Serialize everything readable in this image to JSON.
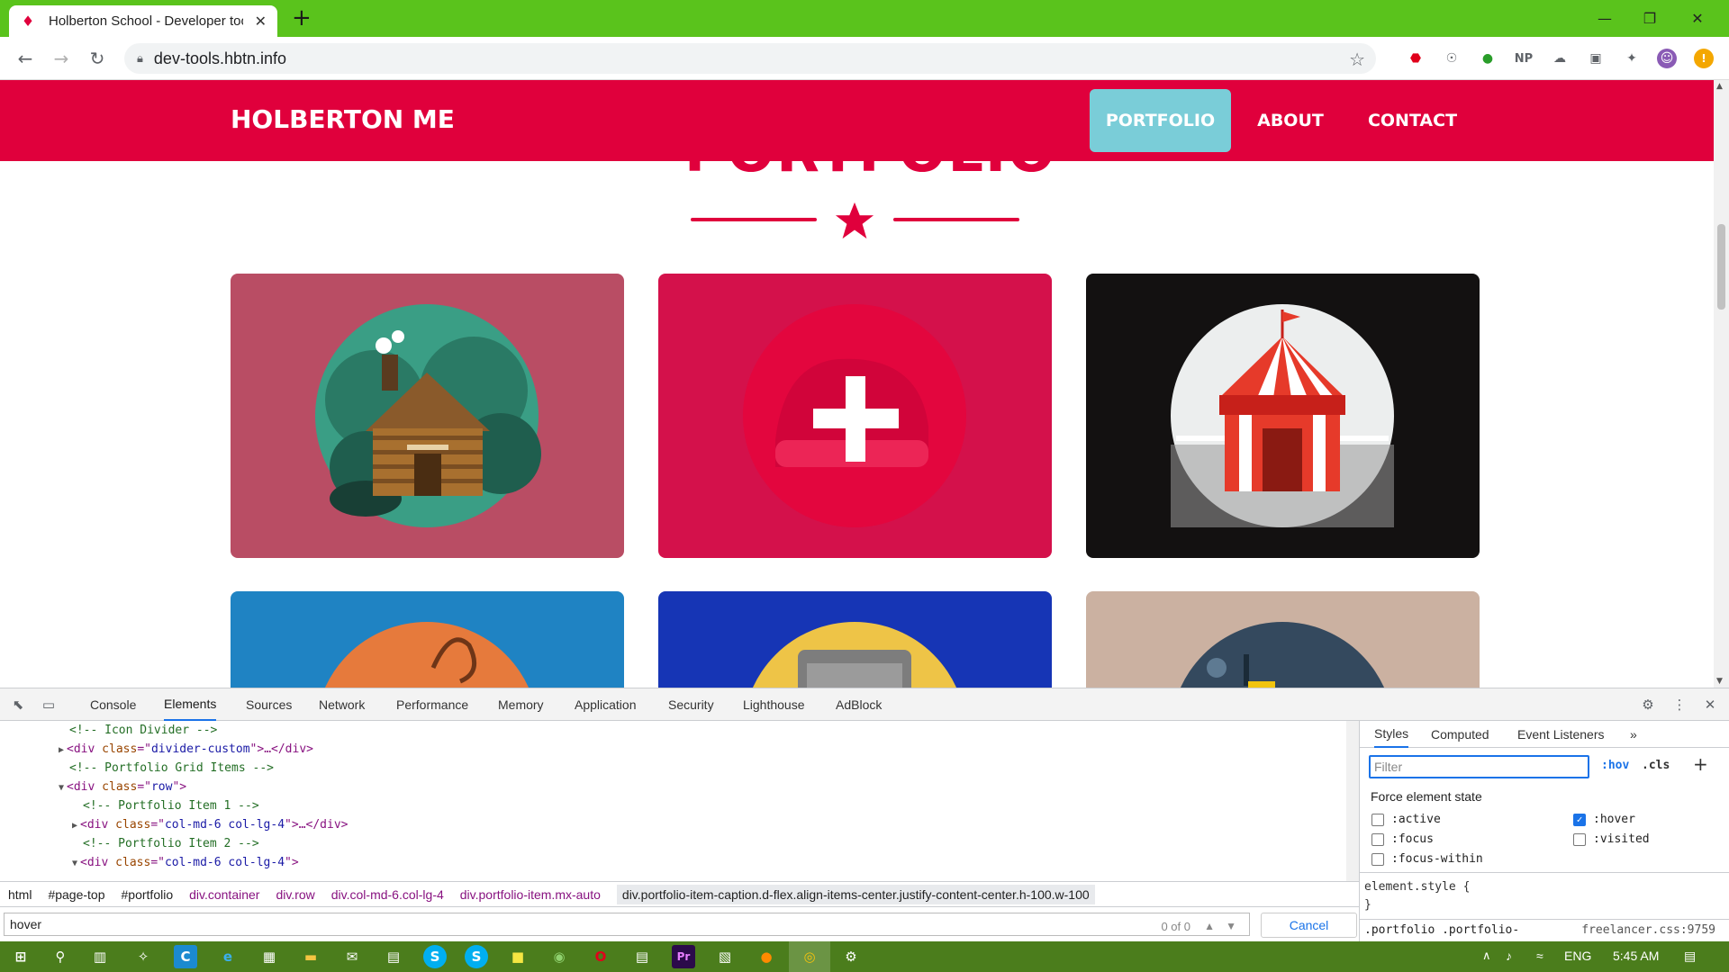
{
  "browser": {
    "tab_title": "Holberton School - Developer tools",
    "url": "dev-tools.hbtn.info",
    "extensions": [
      "adblock-icon",
      "key-icon",
      "globe-icon",
      "NP",
      "cloud-icon",
      "camera-icon",
      "puzzle-icon",
      "avatar",
      "update-icon"
    ]
  },
  "site": {
    "brand": "HOLBERTON ME",
    "nav": [
      "PORTFOLIO",
      "ABOUT",
      "CONTACT"
    ],
    "active_nav": "PORTFOLIO",
    "colors": {
      "primary": "#e0003c",
      "active_nav": "#7acdd8"
    },
    "portfolio_cards": [
      {
        "name": "cabin",
        "bg": "#b94d64"
      },
      {
        "name": "cake",
        "bg": "#d4114b"
      },
      {
        "name": "circus",
        "bg": "#131111"
      },
      {
        "name": "game",
        "bg": "#1f83c3"
      },
      {
        "name": "safe",
        "bg": "#1635b5"
      },
      {
        "name": "submarine",
        "bg": "#cbb1a1"
      }
    ]
  },
  "devtools": {
    "tabs": [
      "Console",
      "Elements",
      "Sources",
      "Network",
      "Performance",
      "Memory",
      "Application",
      "Security",
      "Lighthouse",
      "AdBlock"
    ],
    "active_tab": "Elements",
    "dom_lines": [
      {
        "comment": "<!-- Icon Divider -->"
      },
      {
        "tag": "div",
        "attr": "class",
        "val": "divider-custom",
        "tail": "…</div>"
      },
      {
        "comment": "<!-- Portfolio Grid Items -->"
      },
      {
        "tag": "div",
        "attr": "class",
        "val": "row",
        "tail": ""
      },
      {
        "comment": "<!-- Portfolio Item 1 -->"
      },
      {
        "tag": "div",
        "attr": "class",
        "val": "col-md-6 col-lg-4",
        "tail": "…</div>"
      },
      {
        "comment": "<!-- Portfolio Item 2 -->"
      },
      {
        "tag": "div",
        "attr": "class",
        "val": "col-md-6 col-lg-4",
        "tail": ""
      }
    ],
    "breadcrumbs": [
      "html",
      "#page-top",
      "#portfolio",
      "div.container",
      "div.row",
      "div.col-md-6.col-lg-4",
      "div.portfolio-item.mx-auto",
      "div.portfolio-item-caption.d-flex.align-items-center.justify-content-center.h-100.w-100"
    ],
    "search": {
      "value": "hover",
      "count": "0 of 0",
      "cancel": "Cancel"
    },
    "styles_tabs": [
      "Styles",
      "Computed",
      "Event Listeners",
      "»"
    ],
    "filter_placeholder": "Filter",
    "hov": ":hov",
    "cls": ".cls",
    "force_state_label": "Force element state",
    "states": [
      {
        "label": ":active",
        "checked": false
      },
      {
        "label": ":hover",
        "checked": true
      },
      {
        "label": ":focus",
        "checked": false
      },
      {
        "label": ":visited",
        "checked": false
      },
      {
        "label": ":focus-within",
        "checked": false
      }
    ],
    "element_style_open": "element.style {",
    "element_style_close": "}",
    "rule_selector": ".portfolio .portfolio-",
    "rule_source": "freelancer.css:9759"
  },
  "taskbar": {
    "lang": "ENG",
    "time": "5:45 AM"
  }
}
